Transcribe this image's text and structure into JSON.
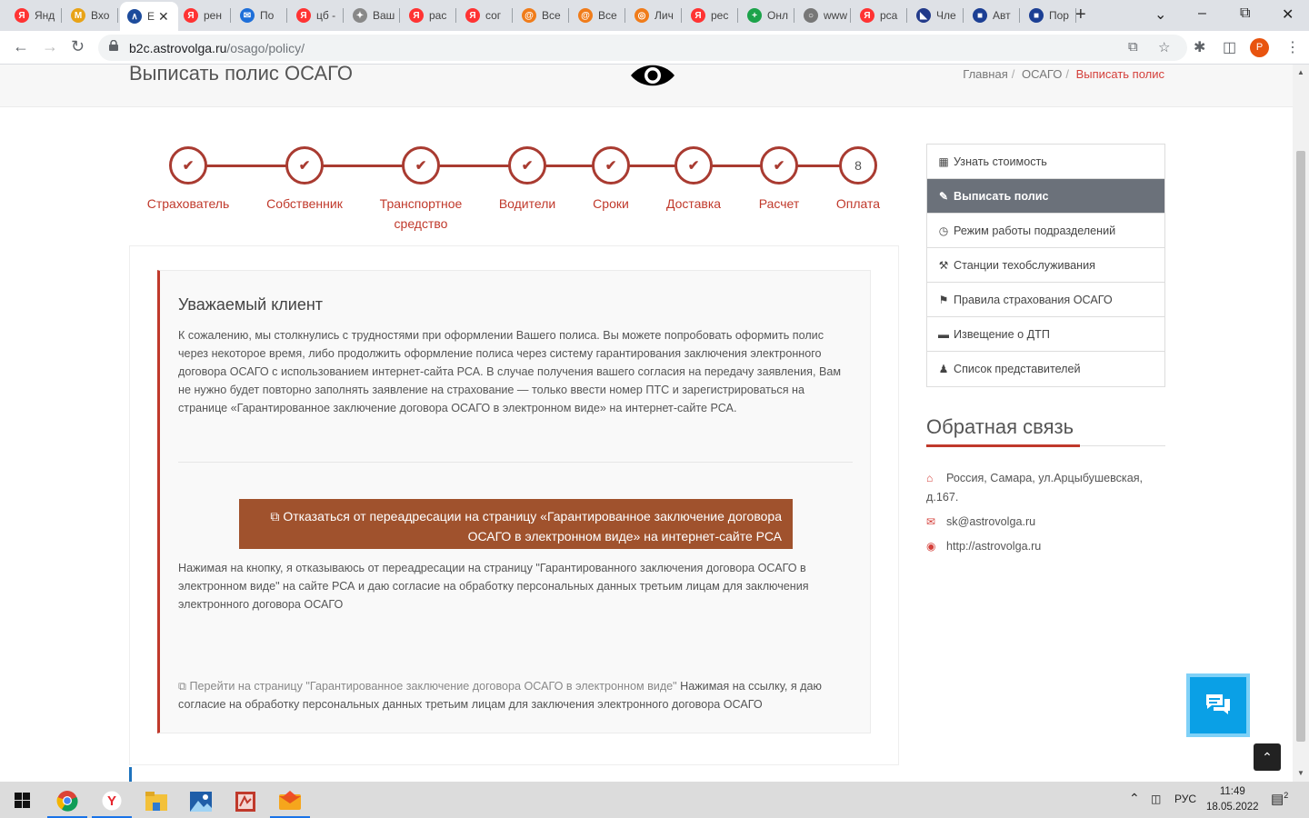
{
  "browser": {
    "tabs": [
      {
        "label": "Янд",
        "icon": "yandex-icon",
        "color": "#ff3333",
        "glyph": "Я"
      },
      {
        "label": "Вхо",
        "icon": "gmail-icon",
        "color": "#e8a317",
        "glyph": "M"
      },
      {
        "label": "Е",
        "icon": "aeroflot-icon",
        "color": "#1d4c9c",
        "glyph": "∧"
      },
      {
        "label": "рен",
        "icon": "yandex-icon",
        "color": "#ff3333",
        "glyph": "Я"
      },
      {
        "label": "По",
        "icon": "mail-icon",
        "color": "#1e6fd9",
        "glyph": "✉"
      },
      {
        "label": "цб -",
        "icon": "yandex-icon",
        "color": "#ff3333",
        "glyph": "Я"
      },
      {
        "label": "Ваш",
        "icon": "emblem-icon",
        "color": "#888888",
        "glyph": "✦"
      },
      {
        "label": "рас",
        "icon": "yandex-icon",
        "color": "#ff3333",
        "glyph": "Я"
      },
      {
        "label": "сог",
        "icon": "yandex-icon",
        "color": "#ff3333",
        "glyph": "Я"
      },
      {
        "label": "Все",
        "icon": "at-icon",
        "color": "#f07c1a",
        "glyph": "@"
      },
      {
        "label": "Все",
        "icon": "at-icon",
        "color": "#f07c1a",
        "glyph": "@"
      },
      {
        "label": "Лич",
        "icon": "swirl-icon",
        "color": "#f07c1a",
        "glyph": "◎"
      },
      {
        "label": "рес",
        "icon": "yandex-icon",
        "color": "#ff3333",
        "glyph": "Я"
      },
      {
        "label": "Онл",
        "icon": "plus-icon",
        "color": "#1ca34a",
        "glyph": "+"
      },
      {
        "label": "www",
        "icon": "globe-icon",
        "color": "#777777",
        "glyph": "○"
      },
      {
        "label": "рса",
        "icon": "yandex-icon",
        "color": "#ff3333",
        "glyph": "Я"
      },
      {
        "label": "Чле",
        "icon": "rsa-icon",
        "color": "#223a8a",
        "glyph": "◣"
      },
      {
        "label": "Авт",
        "icon": "flag-icon",
        "color": "#1c3f94",
        "glyph": "■"
      },
      {
        "label": "Пор",
        "icon": "flag-icon",
        "color": "#1c3f94",
        "glyph": "■"
      }
    ],
    "url_host": "b2c.astrovolga.ru",
    "url_path": "/osago/policy/",
    "profile_letter": "P"
  },
  "page": {
    "title": "Выписать полис ОСАГО",
    "breadcrumbs": [
      "Главная",
      "ОСАГО",
      "Выписать полис"
    ],
    "steps": [
      {
        "label": "Страхователь",
        "done": true
      },
      {
        "label": "Собственник",
        "done": true
      },
      {
        "label": "Транспортное средство",
        "done": true
      },
      {
        "label": "Водители",
        "done": true
      },
      {
        "label": "Сроки",
        "done": true
      },
      {
        "label": "Доставка",
        "done": true
      },
      {
        "label": "Расчет",
        "done": true
      },
      {
        "label": "Оплата",
        "done": false,
        "number": "8"
      }
    ],
    "alert": {
      "heading": "Уважаемый клиент",
      "text": "К сожалению, мы столкнулись с трудностями при оформлении Вашего полиса. Вы можете попробовать оформить полис через некоторое время, либо продолжить оформление полиса через систему гарантирования заключения электронного договора ОСАГО с использованием интернет-сайта РСА. В случае получения вашего согласия на передачу заявления, Вам не нужно будет повторно заполнять заявление на страхование — только ввести номер ПТС и зарегистрироваться на странице «Гарантированное заключение договора ОСАГО в электронном виде» на интернет-сайте РСА.",
      "button_label": "Отказаться от переадресации на страницу «Гарантированное заключение договора ОСАГО в электронном виде» на интернет-сайте РСА",
      "note": "Нажимая на кнопку, я отказываюсь от переадресации на страницу \"Гарантированного заключения договора ОСАГО в электронном виде\" на сайте РСА и даю согласие на обработку персональных данных третьим лицам для заключения электронного договора ОСАГО",
      "link_label": "Перейти на страницу \"Гарантированное заключение договора ОСАГО в электронном виде\"",
      "link_note": "Нажимая на ссылку, я даю согласие на обработку персональных данных третьим лицам для заключения электронного договора ОСАГО"
    },
    "sidebar": {
      "items": [
        {
          "label": "Узнать стоимость",
          "icon": "calculator-icon",
          "glyph": "▦",
          "active": false
        },
        {
          "label": "Выписать полис",
          "icon": "edit-icon",
          "glyph": "✎",
          "active": true
        },
        {
          "label": "Режим работы подразделений",
          "icon": "clock-icon",
          "glyph": "◷",
          "active": false
        },
        {
          "label": "Станции техобслуживания",
          "icon": "wrench-icon",
          "glyph": "⚒",
          "active": false
        },
        {
          "label": "Правила страхования ОСАГО",
          "icon": "graduation-cap-icon",
          "glyph": "⚑",
          "active": false
        },
        {
          "label": "Извещение о ДТП",
          "icon": "car-icon",
          "glyph": "▬",
          "active": false
        },
        {
          "label": "Список представителей",
          "icon": "users-icon",
          "glyph": "♟",
          "active": false
        }
      ]
    },
    "feedback": {
      "title": "Обратная связь",
      "address_line1": "Россия, Самара, ул.Арцыбушевская,",
      "address_line2": "д.167.",
      "email": "sk@astrovolga.ru",
      "site": "http://astrovolga.ru"
    }
  },
  "taskbar": {
    "lang": "РУС",
    "time": "11:49",
    "date": "18.05.2022",
    "notif_count": "2"
  },
  "colors": {
    "accent_red": "#a93b31",
    "button_brown": "#a0522d",
    "menu_active": "#6b717a",
    "chat_blue": "#0aa0e6"
  }
}
